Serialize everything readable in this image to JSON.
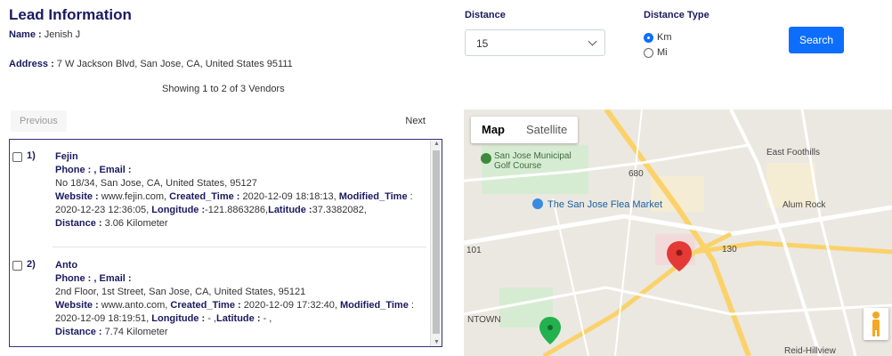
{
  "lead": {
    "title": "Lead Information",
    "name_label": "Name :",
    "name_value": " Jenish J",
    "address_label": "Address :",
    "address_value": " 7 W Jackson Blvd, San Jose, CA, United States 95111",
    "showing": "Showing 1 to 2 of 3 Vendors"
  },
  "pager": {
    "previous": "Previous",
    "next": "Next"
  },
  "vendors": [
    {
      "num": "1)",
      "name": "Fejin",
      "contact": "Phone : , Email :",
      "address": "No 18/34, San Jose, CA, United States, 95127",
      "website_label": "Website :",
      "website": " www.fejin.com, ",
      "created_label": "Created_Time :",
      "created": " 2020-12-09 18:18:13, ",
      "modified_label": "Modified_Time",
      "modified": " : 2020-12-23 12:36:05, ",
      "lon_label": "Longitude :",
      "lon": "-121.8863286,",
      "lat_label": "Latitude :",
      "lat": "37.3382082,",
      "distance_label": "Distance :",
      "distance": " 3.06 Kilometer"
    },
    {
      "num": "2)",
      "name": "Anto",
      "contact": "Phone : , Email :",
      "address": "2nd Floor, 1st Street, San Jose, CA, United States, 95121",
      "website_label": "Website :",
      "website": " www.anto.com, ",
      "created_label": "Created_Time :",
      "created": " 2020-12-09 17:32:40, ",
      "modified_label": "Modified_Time",
      "modified": " : 2020-12-09 18:19:51, ",
      "lon_label": "Longitude :",
      "lon": " - ,",
      "lat_label": "Latitude :",
      "lat": " - ,",
      "distance_label": "Distance :",
      "distance": " 7.74 Kilometer"
    }
  ],
  "filters": {
    "distance_label": "Distance",
    "distance_value": "15",
    "distance_type_label": "Distance Type",
    "opt_km": "Km",
    "opt_mi": "Mi",
    "selected": "Km",
    "search": "Search"
  },
  "map": {
    "tab_map": "Map",
    "tab_satellite": "Satellite",
    "labels": {
      "golf": "San Jose Municipal",
      "golf2": "Golf Course",
      "flea": "The San Jose Flea Market",
      "east_foothills": "East Foothills",
      "alum_rock": "Alum Rock",
      "downtown": "NTOWN",
      "reid": "Reid-Hillview",
      "hwy_101": "101",
      "hwy_680": "680",
      "hwy_130": "130"
    }
  },
  "colors": {
    "title": "#1a1a5e",
    "primary": "#0d6efd",
    "pin_red": "#e53935",
    "pin_green": "#22b14c"
  }
}
